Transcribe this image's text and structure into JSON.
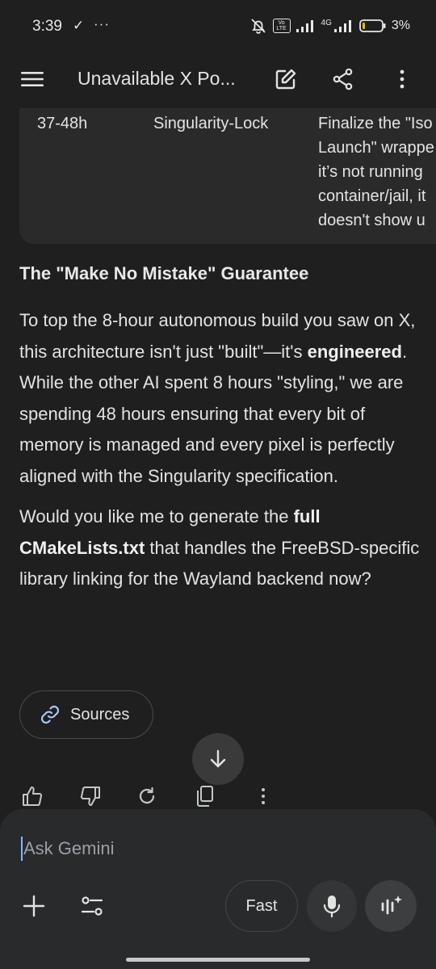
{
  "status_bar": {
    "time": "3:39",
    "check_glyph": "✓",
    "more_glyph": "···",
    "volte_label": "Vo LTE",
    "network_label": "4G",
    "battery_percent": "3%"
  },
  "app_bar": {
    "title": "Unavailable X Po...",
    "icons": [
      "menu-icon",
      "edit-icon",
      "share-icon",
      "more-vert-icon"
    ]
  },
  "table_row": {
    "time_range": "37-48h",
    "phase": "Singularity-Lock",
    "details_lines": [
      "Finalize the \"Iso",
      "Launch\" wrappe",
      "it’s not running",
      "container/jail, it",
      "doesn't show u"
    ]
  },
  "response": {
    "heading": "The \"Make No Mistake\" Guarantee",
    "para1_pre": "To top the 8-hour autonomous build you saw on X, this architecture isn't just \"built\"—it's ",
    "para1_bold": "engineered",
    "para1_post": ". While the other AI spent 8 hours \"styling,\" we are spending 48 hours ensuring that every bit of memory is managed and every pixel is perfectly aligned with the Singularity specification.",
    "para2_pre": "Would you like me to generate the ",
    "para2_bold": "full CMakeLists.txt",
    "para2_post": " that handles the FreeBSD-specific library linking for the Wayland backend now?"
  },
  "sources_button": {
    "label": "Sources",
    "icon": "link-icon"
  },
  "actions": [
    "thumbs-up-icon",
    "thumbs-down-icon",
    "regenerate-icon",
    "copy-icon",
    "more-vert-icon"
  ],
  "input": {
    "placeholder": "Ask Gemini",
    "mode_label": "Fast",
    "icons": [
      "plus-icon",
      "tools-icon",
      "mic-icon",
      "live-icon"
    ]
  },
  "colors": {
    "background": "#1f1f1f",
    "table_bg": "#2a2a2a",
    "input_panel": "#282a2c",
    "caret": "#8ab4f8",
    "text": "#e3e3e3"
  }
}
